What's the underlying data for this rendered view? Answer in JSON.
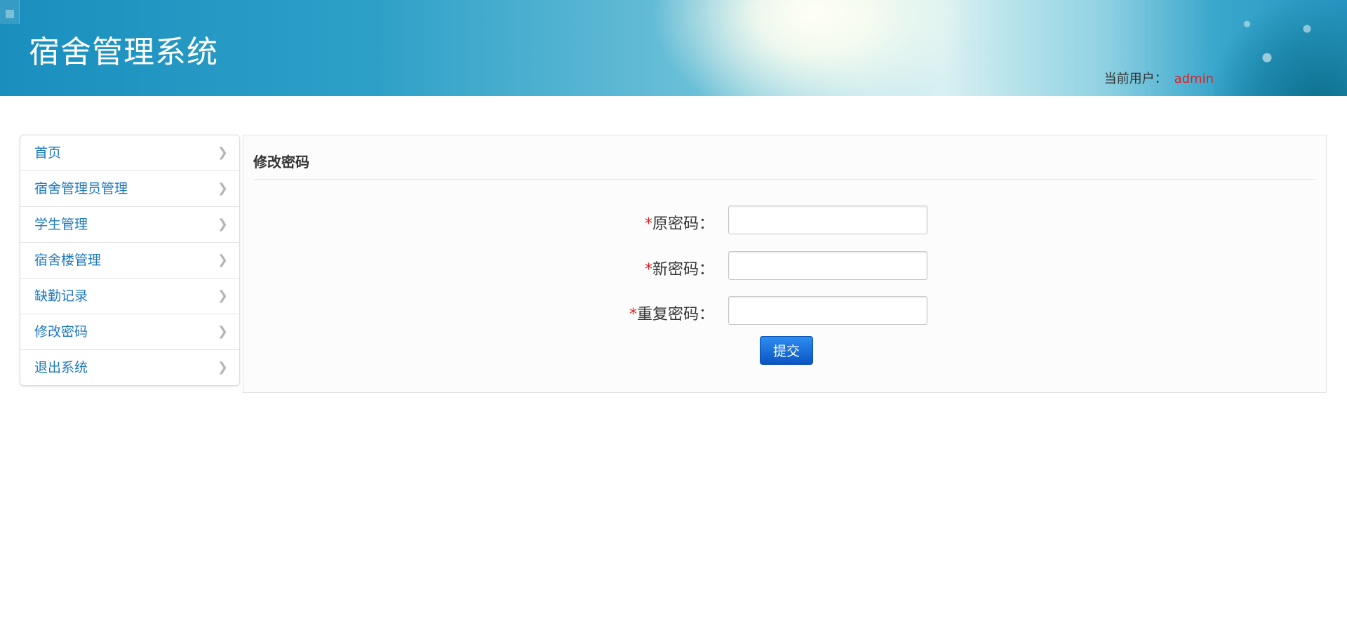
{
  "header": {
    "title": "宿舍管理系统",
    "user_label": "当前用户：",
    "username": "admin"
  },
  "sidebar": {
    "items": [
      {
        "label": "首页"
      },
      {
        "label": "宿舍管理员管理"
      },
      {
        "label": "学生管理"
      },
      {
        "label": "宿舍楼管理"
      },
      {
        "label": "缺勤记录"
      },
      {
        "label": "修改密码"
      },
      {
        "label": "退出系统"
      }
    ],
    "chevron_icon": "chevron-right-icon"
  },
  "panel": {
    "title": "修改密码",
    "fields": [
      {
        "required_mark": "*",
        "label": "原密码：",
        "value": ""
      },
      {
        "required_mark": "*",
        "label": "新密码：",
        "value": ""
      },
      {
        "required_mark": "*",
        "label": "重复密码：",
        "value": ""
      }
    ],
    "submit_label": "提交"
  },
  "colors": {
    "link": "#1b78c0",
    "required": "#e02020",
    "username": "#e02020",
    "button": "#0b56c4"
  }
}
